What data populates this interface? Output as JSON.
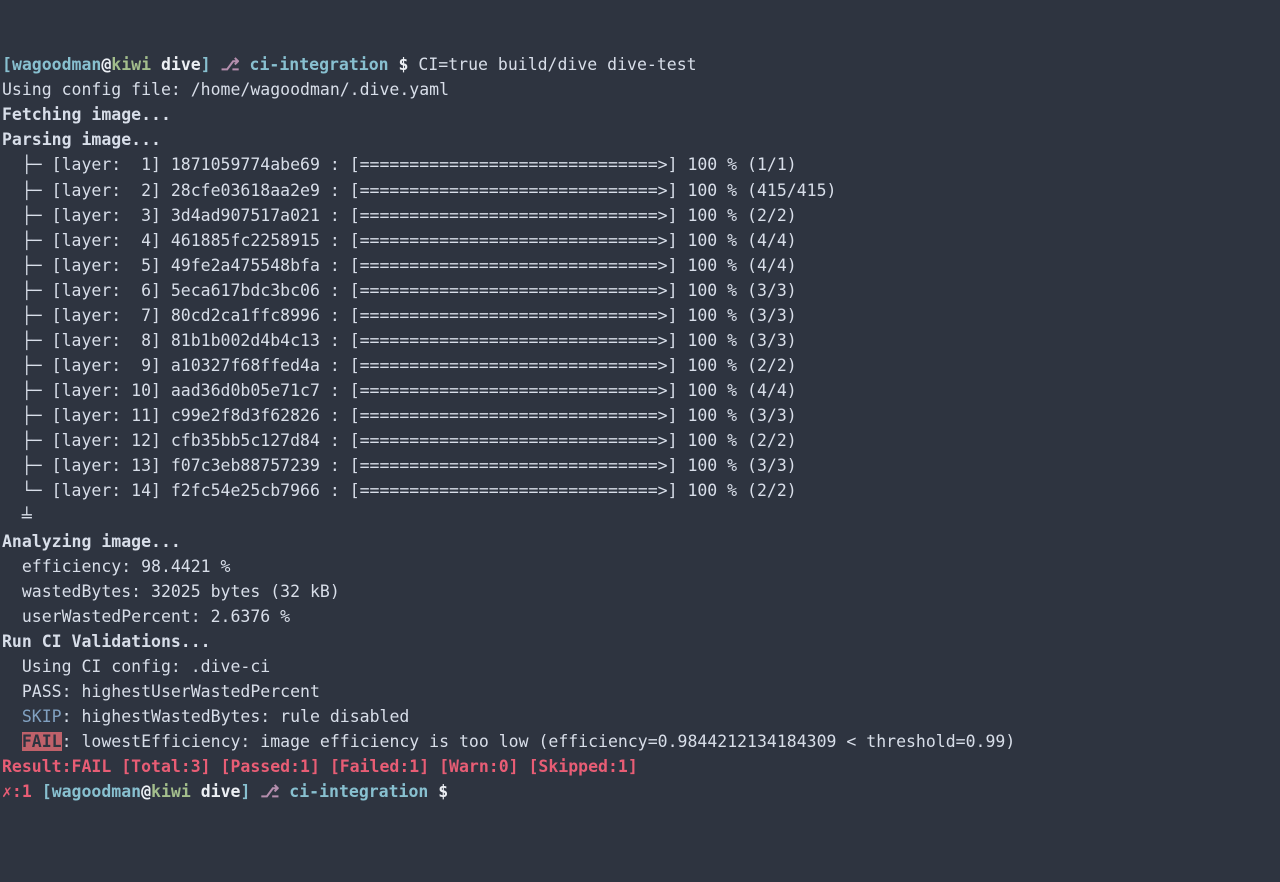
{
  "prompt1": {
    "open": "[",
    "user": "wagoodman",
    "at": "@",
    "host": "kiwi",
    "dir": " dive",
    "close": "]",
    "branch_sym": " ⎇ ",
    "branch": "ci-integration",
    "dollar": " $ ",
    "cmd": "CI=true build/dive dive-test"
  },
  "config_line": "Using config file: /home/wagoodman/.dive.yaml",
  "fetching": "Fetching image...",
  "parsing": "Parsing image...",
  "layers": [
    {
      "tree": "  ├─ ",
      "label": "[layer:  1] 1871059774abe69 : ",
      "bar": "[==============================>] 100 % (1/1)"
    },
    {
      "tree": "  ├─ ",
      "label": "[layer:  2] 28cfe03618aa2e9 : ",
      "bar": "[==============================>] 100 % (415/415)"
    },
    {
      "tree": "  ├─ ",
      "label": "[layer:  3] 3d4ad907517a021 : ",
      "bar": "[==============================>] 100 % (2/2)"
    },
    {
      "tree": "  ├─ ",
      "label": "[layer:  4] 461885fc2258915 : ",
      "bar": "[==============================>] 100 % (4/4)"
    },
    {
      "tree": "  ├─ ",
      "label": "[layer:  5] 49fe2a475548bfa : ",
      "bar": "[==============================>] 100 % (4/4)"
    },
    {
      "tree": "  ├─ ",
      "label": "[layer:  6] 5eca617bdc3bc06 : ",
      "bar": "[==============================>] 100 % (3/3)"
    },
    {
      "tree": "  ├─ ",
      "label": "[layer:  7] 80cd2ca1ffc8996 : ",
      "bar": "[==============================>] 100 % (3/3)"
    },
    {
      "tree": "  ├─ ",
      "label": "[layer:  8] 81b1b002d4b4c13 : ",
      "bar": "[==============================>] 100 % (3/3)"
    },
    {
      "tree": "  ├─ ",
      "label": "[layer:  9] a10327f68ffed4a : ",
      "bar": "[==============================>] 100 % (2/2)"
    },
    {
      "tree": "  ├─ ",
      "label": "[layer: 10] aad36d0b05e71c7 : ",
      "bar": "[==============================>] 100 % (4/4)"
    },
    {
      "tree": "  ├─ ",
      "label": "[layer: 11] c99e2f8d3f62826 : ",
      "bar": "[==============================>] 100 % (3/3)"
    },
    {
      "tree": "  ├─ ",
      "label": "[layer: 12] cfb35bb5c127d84 : ",
      "bar": "[==============================>] 100 % (2/2)"
    },
    {
      "tree": "  ├─ ",
      "label": "[layer: 13] f07c3eb88757239 : ",
      "bar": "[==============================>] 100 % (3/3)"
    },
    {
      "tree": "  └─ ",
      "label": "[layer: 14] f2fc54e25cb7966 : ",
      "bar": "[==============================>] 100 % (2/2)"
    }
  ],
  "tree_end": "  ╧ ",
  "analyzing": "Analyzing image...",
  "efficiency": "  efficiency: 98.4421 %",
  "wasted_bytes": "  wastedBytes: 32025 bytes (32 kB)",
  "user_wasted": "  userWastedPercent: 2.6376 %",
  "run_validations": "Run CI Validations...",
  "using_config": "  Using CI config: .dive-ci",
  "pass_line": "  PASS: highestUserWastedPercent",
  "skip": {
    "pre": "  ",
    "tag": "SKIP",
    "rest": ": highestWastedBytes: rule disabled"
  },
  "fail": {
    "pre": "  ",
    "tag": "FAIL",
    "rest": ": lowestEfficiency: image efficiency is too low (efficiency=0.9844212134184309 < threshold=0.99)"
  },
  "result": "Result:FAIL [Total:3] [Passed:1] [Failed:1] [Warn:0] [Skipped:1]",
  "prompt2": {
    "exit": "✗:1 ",
    "open": "[",
    "user": "wagoodman",
    "at": "@",
    "host": "kiwi",
    "dir": " dive",
    "close": "]",
    "branch_sym": " ⎇ ",
    "branch": "ci-integration",
    "dollar": " $ "
  }
}
